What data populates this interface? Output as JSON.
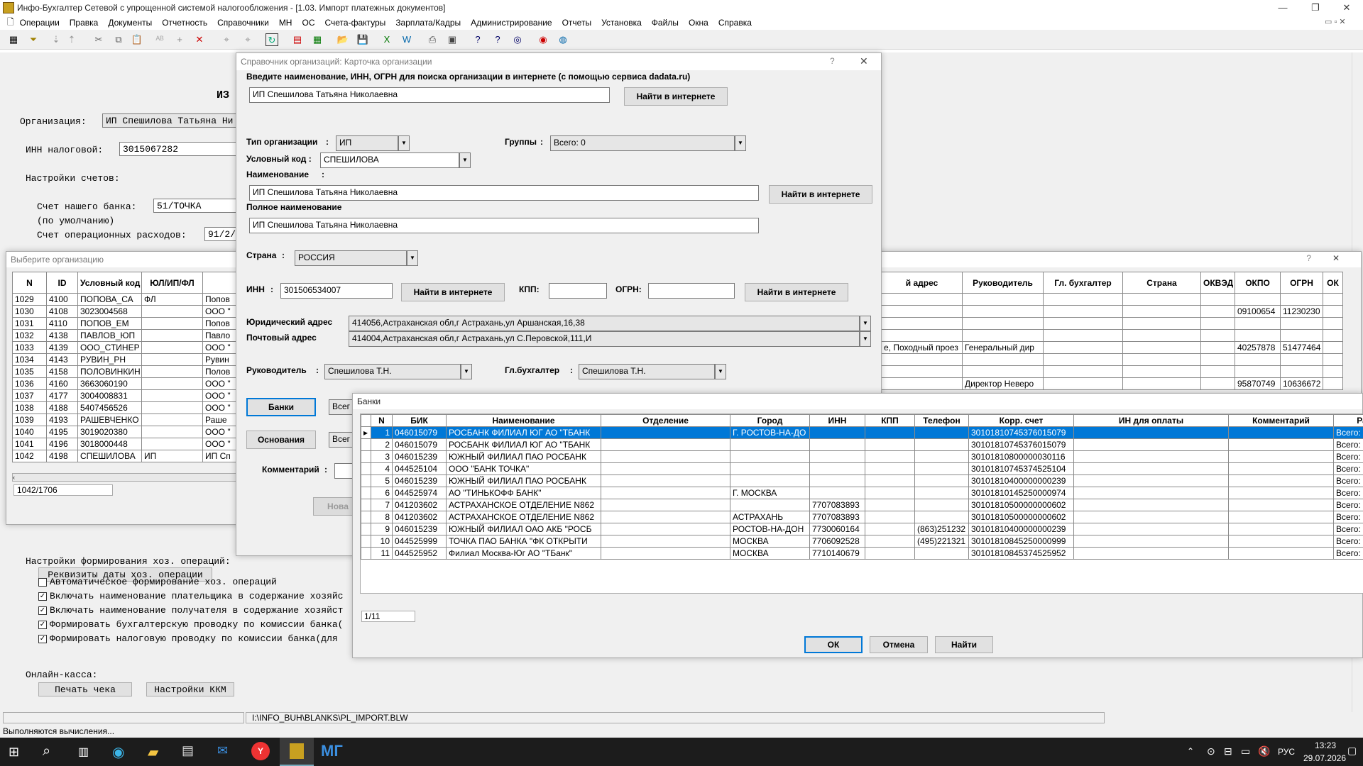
{
  "app": {
    "title": "Инфо-Бухгалтер Сетевой с упрощенной системой налогообложения - [1.03. Импорт платежных документов]"
  },
  "menu": [
    "Операции",
    "Правка",
    "Документы",
    "Отчетность",
    "Справочники",
    "МН",
    "ОС",
    "Счета-фактуры",
    "Зарплата/Кадры",
    "Администрирование",
    "Отчеты",
    "Установка",
    "Файлы",
    "Окна",
    "Справка"
  ],
  "bg": {
    "heading": "ИЗ",
    "org_label": "Организация:",
    "org_value": "ИП Спешилова Татьяна Ни",
    "inn_label": "ИНН налоговой:",
    "inn_value": "3015067282",
    "acc_settings": "Настройки счетов:",
    "bank_acc_label": "Счет нашего банка:",
    "bank_acc_value": "51/ТОЧКА",
    "default_label": "(по умолчанию)",
    "ops_label": "Счет операционных расходов:",
    "ops_value": "91/2/",
    "hoz_settings": "Настройки формирования хоз. операций:",
    "req_button": "Реквизиты даты хоз. операции",
    "checks": [
      {
        "label": "Автоматическое формирование хоз. операций",
        "checked": false
      },
      {
        "label": "Включать наименование плательщика в содержание хозяйс",
        "checked": true
      },
      {
        "label": "Включать наименование получателя в содержание хозяйст",
        "checked": true
      },
      {
        "label": "Формировать бухгалтерскую проводку по комиссии банка(",
        "checked": true
      },
      {
        "label": "Формировать налоговую проводку по комиссии банка(для ",
        "checked": true
      }
    ],
    "online_label": "Онлайн-касса:",
    "print_button": "Печать чека",
    "kkm_button": "Настройки ККМ"
  },
  "orgwin": {
    "title": "Выберите организацию",
    "headers": [
      "N",
      "ID",
      "Условный код",
      "ЮЛ/ИП/ФЛ",
      ""
    ],
    "rows": [
      [
        "1029",
        "4100",
        "ПОПОВА_СА",
        "ФЛ",
        "Попов"
      ],
      [
        "1030",
        "4108",
        "3023004568",
        "",
        "ООО \""
      ],
      [
        "1031",
        "4110",
        "ПОПОВ_ЕМ",
        "",
        "Попов"
      ],
      [
        "1032",
        "4138",
        "ПАВЛОВ_ЮП",
        "",
        "Павло"
      ],
      [
        "1033",
        "4139",
        "ООО_СТИНЕР",
        "",
        "ООО \""
      ],
      [
        "1034",
        "4143",
        "РУВИН_РН",
        "",
        "Рувин"
      ],
      [
        "1035",
        "4158",
        "ПОЛОВИНКИН",
        "",
        "Полов"
      ],
      [
        "1036",
        "4160",
        "3663060190",
        "",
        "ООО \""
      ],
      [
        "1037",
        "4177",
        "3004008831",
        "",
        "ООО \""
      ],
      [
        "1038",
        "4188",
        "5407456526",
        "",
        "ООО \""
      ],
      [
        "1039",
        "4193",
        "РАШЕВЧЕНКО",
        "",
        "Раше"
      ],
      [
        "1040",
        "4195",
        "3019020380",
        "",
        "ООО \""
      ],
      [
        "1041",
        "4196",
        "3018000448",
        "",
        "ООО \""
      ],
      [
        "1042",
        "4198",
        "СПЕШИЛОВА",
        "ИП",
        "ИП Сп"
      ]
    ],
    "counter": "1042/1706",
    "right_headers": [
      "й адрес",
      "Руководитель",
      "Гл. бухгалтер",
      "Страна",
      "ОКВЭД",
      "ОКПО",
      "ОГРН",
      "ОК"
    ],
    "right_rows": [
      [
        "",
        "",
        "",
        "",
        "",
        "",
        ""
      ],
      [
        "",
        "",
        "",
        "",
        "",
        "09100654",
        "11230230"
      ],
      [
        "",
        "",
        "",
        "",
        "",
        "",
        ""
      ],
      [
        "",
        "",
        "",
        "",
        "",
        "",
        ""
      ],
      [
        "е, Походный проез",
        "Генеральный дир",
        "",
        "",
        "",
        "40257878",
        "51477464"
      ],
      [
        "",
        "",
        "",
        "",
        "",
        "",
        ""
      ],
      [
        "",
        "",
        "",
        "",
        "",
        "",
        ""
      ],
      [
        "",
        "Директор Неверо",
        "",
        "",
        "",
        "95870749",
        "10636672"
      ]
    ]
  },
  "card": {
    "title": "Справочник организаций: Карточка организации",
    "help": "?",
    "search_label": "Введите наименование, ИНН, ОГРН для поиска организации в интернете (с помощью сервиса dadata.ru)",
    "search_value": "ИП Спешилова Татьяна Николаевна",
    "find_btn": "Найти в интернете",
    "type_label": "Тип организации",
    "type_value": "ИП",
    "groups_label": "Группы",
    "groups_value": "Всего: 0",
    "code_label": "Условный код :",
    "code_value": "СПЕШИЛОВА",
    "name_label": "Наименование",
    "name_value": "ИП Спешилова Татьяна Николаевна",
    "fullname_label": "Полное наименование",
    "fullname_value": "ИП Спешилова Татьяна Николаевна",
    "country_label": "Страна",
    "country_value": "РОССИЯ",
    "inn_label": "ИНН",
    "inn_value": "301506534007",
    "kpp_label": "КПП:",
    "ogrn_label": "ОГРН:",
    "legal_label": "Юридический адрес",
    "legal_value": "414056,Астраханская обл,г Астрахань,ул Аршанская,16,38",
    "post_label": "Почтовый адрес",
    "post_value": "414004,Астраханская обл,г Астрахань,ул С.Перовской,111,И",
    "head_label": "Руководитель",
    "head_value": "Спешилова Т.Н.",
    "acc_label": "Гл.бухгалтер",
    "acc_value": "Спешилова Т.Н.",
    "banks_btn": "Банки",
    "banks_field": "Всег",
    "basis_btn": "Основания",
    "basis_field": "Всег",
    "comment_label": "Комментарий",
    "new_btn": "Нова"
  },
  "banks": {
    "title": "Банки",
    "headers": [
      "N",
      "БИК",
      "Наименование",
      "Отделение",
      "Город",
      "ИНН",
      "КПП",
      "Телефон",
      "Корр. счет",
      "ИН для оплаты",
      "Комментарий",
      "Расче"
    ],
    "rows": [
      [
        "1",
        "046015079",
        "РОСБАНК ФИЛИАЛ ЮГ АО \"ТБАНК",
        "",
        "Г. РОСТОВ-НА-ДО",
        "",
        "",
        "",
        "30101810745376015079",
        "",
        "",
        "Всего:"
      ],
      [
        "2",
        "046015079",
        "РОСБАНК ФИЛИАЛ ЮГ АО \"ТБАНК",
        "",
        "",
        "",
        "",
        "",
        "30101810745376015079",
        "",
        "",
        "Всего:"
      ],
      [
        "3",
        "046015239",
        "ЮЖНЫЙ ФИЛИАЛ ПАО РОСБАНК",
        "",
        "",
        "",
        "",
        "",
        "30101810800000030116",
        "",
        "",
        "Всего:"
      ],
      [
        "4",
        "044525104",
        "ООО \"БАНК ТОЧКА\"",
        "",
        "",
        "",
        "",
        "",
        "30101810745374525104",
        "",
        "",
        "Всего:"
      ],
      [
        "5",
        "046015239",
        "ЮЖНЫЙ ФИЛИАЛ ПАО РОСБАНК",
        "",
        "",
        "",
        "",
        "",
        "30101810400000000239",
        "",
        "",
        "Всего:"
      ],
      [
        "6",
        "044525974",
        "АО \"ТИНЬКОФФ БАНК\"",
        "",
        "Г. МОСКВА",
        "",
        "",
        "",
        "30101810145250000974",
        "",
        "",
        "Всего:"
      ],
      [
        "7",
        "041203602",
        "АСТРАХАНСКОЕ ОТДЕЛЕНИЕ N862",
        "",
        "",
        "7707083893",
        "",
        "",
        "30101810500000000602",
        "",
        "",
        "Всего:"
      ],
      [
        "8",
        "041203602",
        "АСТРАХАНСКОЕ ОТДЕЛЕНИЕ N862",
        "",
        "АСТРАХАНЬ",
        "7707083893",
        "",
        "",
        "30101810500000000602",
        "",
        "",
        "Всего:"
      ],
      [
        "9",
        "046015239",
        "ЮЖНЫЙ ФИЛИАЛ ОАО АКБ \"РОСБ",
        "",
        "РОСТОВ-НА-ДОН",
        "7730060164",
        "",
        "(863)251232",
        "30101810400000000239",
        "",
        "",
        "Всего:"
      ],
      [
        "10",
        "044525999",
        "ТОЧКА ПАО БАНКА \"ФК ОТКРЫТИ",
        "",
        "МОСКВА",
        "7706092528",
        "",
        "(495)221321",
        "30101810845250000999",
        "",
        "",
        "Всего:"
      ],
      [
        "11",
        "044525952",
        "Филиал Москва-Юг АО \"ТБанк\"",
        "",
        "МОСКВА",
        "7710140679",
        "",
        "",
        "30101810845374525952",
        "",
        "",
        "Всего:"
      ]
    ],
    "counter": "1/11",
    "ok": "ОК",
    "cancel": "Отмена",
    "find": "Найти"
  },
  "status": {
    "path": "I:\\INFO_BUH\\BLANKS\\PL_IMPORT.BLW",
    "message": "Выполняются вычисления..."
  },
  "taskbar": {
    "lang": "РУС",
    "time": "13:23",
    "date": "29.07.2026"
  },
  "colors": {
    "selection": "#0078d7",
    "taskbar": "#1c1c1c"
  }
}
